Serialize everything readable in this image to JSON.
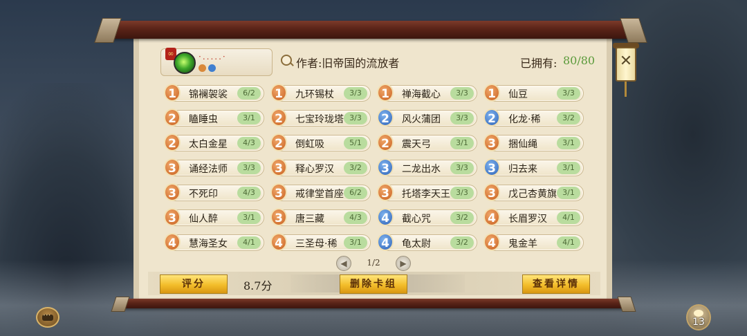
{
  "header": {
    "deck_name": "·.....·",
    "author": "作者:旧帝国的流放者",
    "owned_label": "已拥有:",
    "owned_value": "80/80"
  },
  "cards": [
    {
      "cost": "1",
      "color": "orange",
      "name": "锦襕袈裟",
      "count": "6/2"
    },
    {
      "cost": "1",
      "color": "orange",
      "name": "九环锡杖",
      "count": "3/3"
    },
    {
      "cost": "1",
      "color": "orange",
      "name": "禅海截心",
      "count": "3/3"
    },
    {
      "cost": "1",
      "color": "orange",
      "name": "仙豆",
      "count": "3/3"
    },
    {
      "cost": "2",
      "color": "orange",
      "name": "瞌睡虫",
      "count": "3/1"
    },
    {
      "cost": "2",
      "color": "orange",
      "name": "七宝玲珑塔",
      "count": "3/3"
    },
    {
      "cost": "2",
      "color": "blue",
      "name": "风火蒲团",
      "count": "3/3"
    },
    {
      "cost": "2",
      "color": "blue",
      "name": "化龙·稀",
      "count": "3/2"
    },
    {
      "cost": "2",
      "color": "orange",
      "name": "太白金星",
      "count": "4/3"
    },
    {
      "cost": "2",
      "color": "orange",
      "name": "倒虹吸",
      "count": "5/1"
    },
    {
      "cost": "2",
      "color": "orange",
      "name": "震天弓",
      "count": "3/1"
    },
    {
      "cost": "3",
      "color": "orange",
      "name": "捆仙绳",
      "count": "3/1"
    },
    {
      "cost": "3",
      "color": "orange",
      "name": "诵经法师",
      "count": "3/3"
    },
    {
      "cost": "3",
      "color": "orange",
      "name": "释心罗汉",
      "count": "3/2"
    },
    {
      "cost": "3",
      "color": "blue",
      "name": "二龙出水",
      "count": "3/3"
    },
    {
      "cost": "3",
      "color": "blue",
      "name": "归去来",
      "count": "3/1"
    },
    {
      "cost": "3",
      "color": "orange",
      "name": "不死印",
      "count": "4/3"
    },
    {
      "cost": "3",
      "color": "orange",
      "name": "戒律堂首座",
      "count": "6/2"
    },
    {
      "cost": "3",
      "color": "orange",
      "name": "托塔李天王",
      "count": "3/3"
    },
    {
      "cost": "3",
      "color": "orange",
      "name": "戊己杏黄旗",
      "count": "3/1"
    },
    {
      "cost": "3",
      "color": "orange",
      "name": "仙人醉",
      "count": "3/1"
    },
    {
      "cost": "3",
      "color": "orange",
      "name": "唐三藏",
      "count": "4/3"
    },
    {
      "cost": "4",
      "color": "blue",
      "name": "截心咒",
      "count": "3/2"
    },
    {
      "cost": "4",
      "color": "orange",
      "name": "长眉罗汉",
      "count": "4/1"
    },
    {
      "cost": "4",
      "color": "orange",
      "name": "慧海圣女",
      "count": "4/1"
    },
    {
      "cost": "4",
      "color": "orange",
      "name": "三圣母·稀",
      "count": "3/1"
    },
    {
      "cost": "4",
      "color": "blue",
      "name": "龟太尉",
      "count": "3/2"
    },
    {
      "cost": "4",
      "color": "orange",
      "name": "鬼金羊",
      "count": "4/1"
    }
  ],
  "pager": {
    "text": "1/2"
  },
  "footer": {
    "score_label": "评分",
    "score_value": "8.7分",
    "delete_label": "删除卡组",
    "detail_label": "查看详情"
  },
  "hud": {
    "gift_count": "13"
  },
  "colors": {
    "orange": "#c9611f",
    "blue": "#2e63b8",
    "count_bg": "#b9dc9e",
    "gold": "#f3bd2a"
  }
}
